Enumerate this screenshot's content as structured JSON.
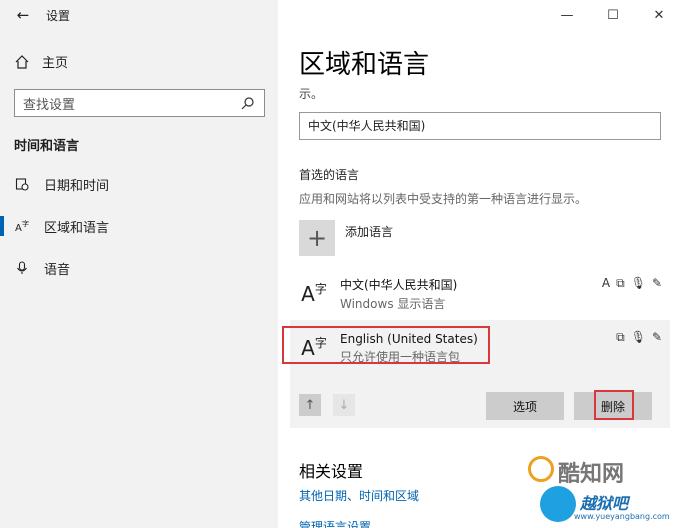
{
  "window": {
    "title": "设置",
    "controls": {
      "minimize": "—",
      "maximize": "☐",
      "close": "✕"
    }
  },
  "sidebar": {
    "home_label": "主页",
    "search_placeholder": "查找设置",
    "section_title": "时间和语言",
    "items": [
      {
        "label": "日期和时间",
        "icon": "calendar-clock-icon"
      },
      {
        "label": "区域和语言",
        "icon": "region-language-icon",
        "active": true
      },
      {
        "label": "语音",
        "icon": "microphone-icon"
      }
    ]
  },
  "main": {
    "page_title": "区域和语言",
    "faded_text": "示。",
    "region_value": "中文(中华人民共和国)",
    "preferred_head": "首选的语言",
    "preferred_desc": "应用和网站将以列表中受支持的第一种语言进行显示。",
    "add_language_label": "添加语言",
    "languages": [
      {
        "name": "中文(中华人民共和国)",
        "subtitle": "Windows 显示语言"
      },
      {
        "name": "English (United States)",
        "subtitle": "只允许使用一种语言包"
      }
    ],
    "options_button": "选项",
    "remove_button": "删除",
    "related_head": "相关设置",
    "related_link_1": "其他日期、时间和区域",
    "related_link_2": "管理语言设置"
  },
  "watermark": {
    "text1": "酷知网",
    "text2": "越狱吧",
    "url": "www.yueyangbang.com"
  },
  "colors": {
    "accent": "#0063b1",
    "highlight_red": "#d9383a",
    "sidebar_bg": "#f2f2f2"
  }
}
